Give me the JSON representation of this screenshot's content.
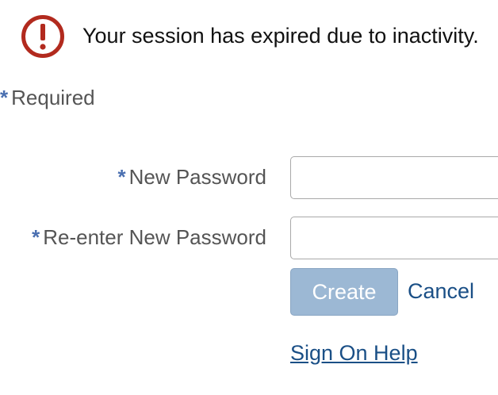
{
  "alert": {
    "icon": "exclamation-circle-icon",
    "icon_color": "#b22a1e",
    "message": "Your session has expired due to inactivity."
  },
  "required_note": {
    "asterisk": "*",
    "label": "Required"
  },
  "form": {
    "new_password": {
      "asterisk": "*",
      "label": "New Password",
      "value": ""
    },
    "reenter_password": {
      "asterisk": "*",
      "label": "Re-enter New Password",
      "value": ""
    },
    "create_label": "Create",
    "cancel_label": "Cancel",
    "help_label": "Sign On Help"
  },
  "colors": {
    "asterisk": "#4a6fb0",
    "link": "#1a4f86",
    "create_button_bg": "#9cb8d4"
  }
}
